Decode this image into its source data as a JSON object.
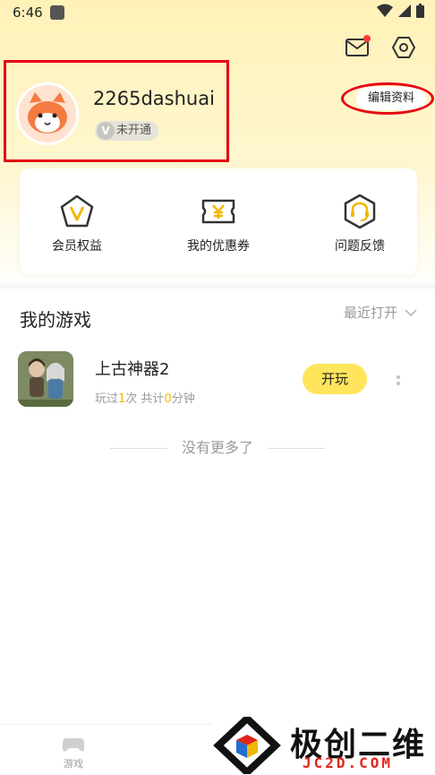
{
  "status_bar": {
    "time": "6:46"
  },
  "profile": {
    "username": "2265dashuai",
    "vip_status": "未开通",
    "vip_letter": "V",
    "edit_label": "编辑资料"
  },
  "shortcuts": [
    {
      "label": "会员权益",
      "icon": "vip-pentagon-icon"
    },
    {
      "label": "我的优惠券",
      "icon": "coupon-icon"
    },
    {
      "label": "问题反馈",
      "icon": "headset-icon"
    }
  ],
  "my_games": {
    "title": "我的游戏",
    "sort_label": "最近打开",
    "games": [
      {
        "title": "上古神器2",
        "stats_prefix": "玩过",
        "play_count": "1",
        "stats_mid": "次 共计",
        "minutes": "0",
        "stats_suffix": "分钟",
        "play_label": "开玩"
      }
    ],
    "end_text": "没有更多了"
  },
  "tabbar": {
    "game_label": "游戏"
  },
  "watermark": {
    "title": "极创二维",
    "url": "JC2D.COM"
  },
  "colors": {
    "accent_yellow": "#ffe55c",
    "highlight": "#f2b705",
    "annotation_red": "#e60012"
  }
}
